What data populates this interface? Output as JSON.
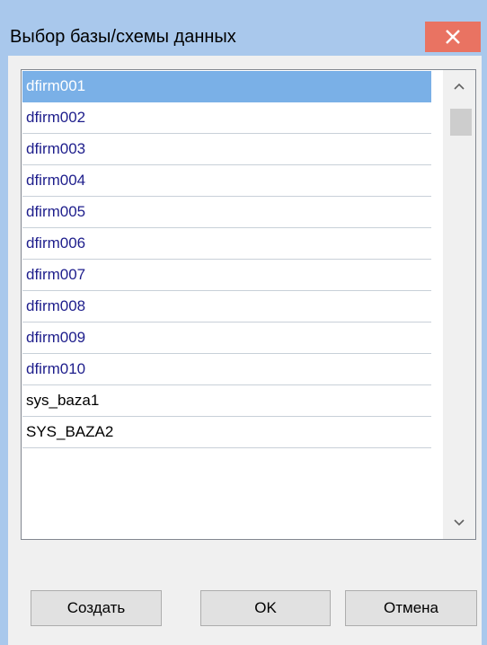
{
  "window": {
    "title": "Выбор базы/схемы данных",
    "accent_color": "#a9c8ec",
    "close_color": "#e97362"
  },
  "list": {
    "selected_index": 0,
    "items": [
      "dfirm001",
      "dfirm002",
      "dfirm003",
      "dfirm004",
      "dfirm005",
      "dfirm006",
      "dfirm007",
      "dfirm008",
      "dfirm009",
      "dfirm010",
      "sys_baza1",
      "SYS_BAZA2"
    ]
  },
  "scrollbar": {
    "up_icon": "chevron-up-icon",
    "down_icon": "chevron-down-icon"
  },
  "buttons": {
    "create_label": "Создать",
    "ok_label": "OK",
    "cancel_label": "Отмена"
  }
}
